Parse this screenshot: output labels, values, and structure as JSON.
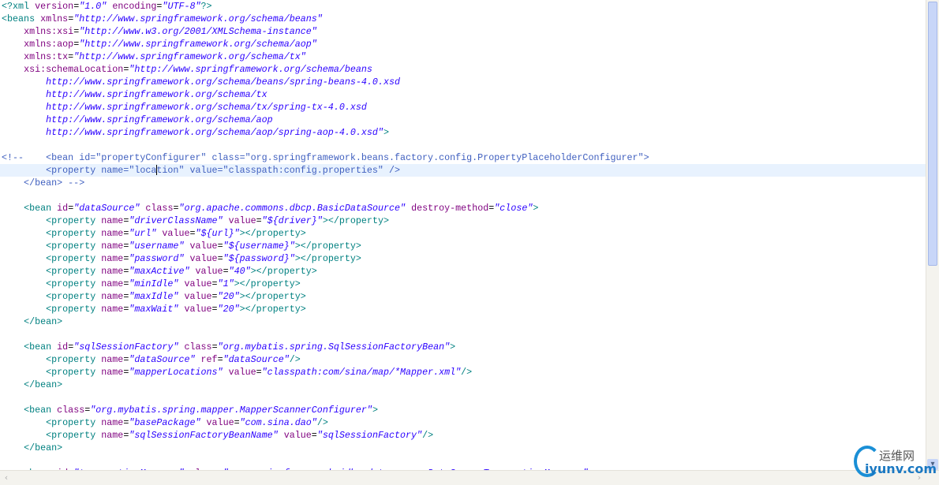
{
  "editor": {
    "current_line": 13,
    "caret": {
      "line": 13,
      "token": 3,
      "offset": 4
    },
    "lines": [
      [
        [
          "pi",
          "<?"
        ],
        [
          "tag",
          "xml "
        ],
        [
          "attr",
          "version"
        ],
        [
          "text",
          "="
        ],
        [
          "val",
          "\"1.0\""
        ],
        [
          "text",
          " "
        ],
        [
          "attr",
          "encoding"
        ],
        [
          "text",
          "="
        ],
        [
          "val",
          "\"UTF-8\""
        ],
        [
          "pi",
          "?>"
        ]
      ],
      [
        [
          "tag",
          "<beans "
        ],
        [
          "attr",
          "xmlns"
        ],
        [
          "text",
          "="
        ],
        [
          "val",
          "\"http://www.springframework.org/schema/beans\""
        ]
      ],
      [
        [
          "text",
          "    "
        ],
        [
          "attr",
          "xmlns:xsi"
        ],
        [
          "text",
          "="
        ],
        [
          "val",
          "\"http://www.w3.org/2001/XMLSchema-instance\""
        ]
      ],
      [
        [
          "text",
          "    "
        ],
        [
          "attr",
          "xmlns:aop"
        ],
        [
          "text",
          "="
        ],
        [
          "val",
          "\"http://www.springframework.org/schema/aop\""
        ]
      ],
      [
        [
          "text",
          "    "
        ],
        [
          "attr",
          "xmlns:tx"
        ],
        [
          "text",
          "="
        ],
        [
          "val",
          "\"http://www.springframework.org/schema/tx\""
        ]
      ],
      [
        [
          "text",
          "    "
        ],
        [
          "attr",
          "xsi:schemaLocation"
        ],
        [
          "text",
          "="
        ],
        [
          "val",
          "\"http://www.springframework.org/schema/beans"
        ]
      ],
      [
        [
          "text",
          "        "
        ],
        [
          "val",
          "http://www.springframework.org/schema/beans/spring-beans-4.0.xsd"
        ]
      ],
      [
        [
          "text",
          "        "
        ],
        [
          "val",
          "http://www.springframework.org/schema/tx"
        ]
      ],
      [
        [
          "text",
          "        "
        ],
        [
          "val",
          "http://www.springframework.org/schema/tx/spring-tx-4.0.xsd"
        ]
      ],
      [
        [
          "text",
          "        "
        ],
        [
          "val",
          "http://www.springframework.org/schema/aop"
        ]
      ],
      [
        [
          "text",
          "        "
        ],
        [
          "val",
          "http://www.springframework.org/schema/aop/spring-aop-4.0.xsd\""
        ],
        [
          "tag",
          ">"
        ]
      ],
      [],
      [
        [
          "com",
          "<!--    <bean id=\"propertyConfigurer\" class=\"org.springframework.beans.factory.config.PropertyPlaceholderConfigurer\">"
        ]
      ],
      [
        [
          "com",
          "        <property name=\"loca"
        ],
        [
          "com",
          "tion\" value=\"classpath:config.properties\" />"
        ]
      ],
      [
        [
          "com",
          "    </bean> -->"
        ]
      ],
      [],
      [
        [
          "text",
          "    "
        ],
        [
          "tag",
          "<bean "
        ],
        [
          "attr",
          "id"
        ],
        [
          "text",
          "="
        ],
        [
          "val",
          "\"dataSource\""
        ],
        [
          "text",
          " "
        ],
        [
          "attr",
          "class"
        ],
        [
          "text",
          "="
        ],
        [
          "val",
          "\"org.apache.commons.dbcp.BasicDataSource\""
        ],
        [
          "text",
          " "
        ],
        [
          "attr",
          "destroy-method"
        ],
        [
          "text",
          "="
        ],
        [
          "val",
          "\"close\""
        ],
        [
          "tag",
          ">"
        ]
      ],
      [
        [
          "text",
          "        "
        ],
        [
          "tag",
          "<property "
        ],
        [
          "attr",
          "name"
        ],
        [
          "text",
          "="
        ],
        [
          "val",
          "\"driverClassName\""
        ],
        [
          "text",
          " "
        ],
        [
          "attr",
          "value"
        ],
        [
          "text",
          "="
        ],
        [
          "val",
          "\"${driver}\""
        ],
        [
          "tag",
          "></property>"
        ]
      ],
      [
        [
          "text",
          "        "
        ],
        [
          "tag",
          "<property "
        ],
        [
          "attr",
          "name"
        ],
        [
          "text",
          "="
        ],
        [
          "val",
          "\"url\""
        ],
        [
          "text",
          " "
        ],
        [
          "attr",
          "value"
        ],
        [
          "text",
          "="
        ],
        [
          "val",
          "\"${url}\""
        ],
        [
          "tag",
          "></property>"
        ]
      ],
      [
        [
          "text",
          "        "
        ],
        [
          "tag",
          "<property "
        ],
        [
          "attr",
          "name"
        ],
        [
          "text",
          "="
        ],
        [
          "val",
          "\"username\""
        ],
        [
          "text",
          " "
        ],
        [
          "attr",
          "value"
        ],
        [
          "text",
          "="
        ],
        [
          "val",
          "\"${username}\""
        ],
        [
          "tag",
          "></property>"
        ]
      ],
      [
        [
          "text",
          "        "
        ],
        [
          "tag",
          "<property "
        ],
        [
          "attr",
          "name"
        ],
        [
          "text",
          "="
        ],
        [
          "val",
          "\"password\""
        ],
        [
          "text",
          " "
        ],
        [
          "attr",
          "value"
        ],
        [
          "text",
          "="
        ],
        [
          "val",
          "\"${password}\""
        ],
        [
          "tag",
          "></property>"
        ]
      ],
      [
        [
          "text",
          "        "
        ],
        [
          "tag",
          "<property "
        ],
        [
          "attr",
          "name"
        ],
        [
          "text",
          "="
        ],
        [
          "val",
          "\"maxActive\""
        ],
        [
          "text",
          " "
        ],
        [
          "attr",
          "value"
        ],
        [
          "text",
          "="
        ],
        [
          "val",
          "\"40\""
        ],
        [
          "tag",
          "></property>"
        ]
      ],
      [
        [
          "text",
          "        "
        ],
        [
          "tag",
          "<property "
        ],
        [
          "attr",
          "name"
        ],
        [
          "text",
          "="
        ],
        [
          "val",
          "\"minIdle\""
        ],
        [
          "text",
          " "
        ],
        [
          "attr",
          "value"
        ],
        [
          "text",
          "="
        ],
        [
          "val",
          "\"1\""
        ],
        [
          "tag",
          "></property>"
        ]
      ],
      [
        [
          "text",
          "        "
        ],
        [
          "tag",
          "<property "
        ],
        [
          "attr",
          "name"
        ],
        [
          "text",
          "="
        ],
        [
          "val",
          "\"maxIdle\""
        ],
        [
          "text",
          " "
        ],
        [
          "attr",
          "value"
        ],
        [
          "text",
          "="
        ],
        [
          "val",
          "\"20\""
        ],
        [
          "tag",
          "></property>"
        ]
      ],
      [
        [
          "text",
          "        "
        ],
        [
          "tag",
          "<property "
        ],
        [
          "attr",
          "name"
        ],
        [
          "text",
          "="
        ],
        [
          "val",
          "\"maxWait\""
        ],
        [
          "text",
          " "
        ],
        [
          "attr",
          "value"
        ],
        [
          "text",
          "="
        ],
        [
          "val",
          "\"20\""
        ],
        [
          "tag",
          "></property>"
        ]
      ],
      [
        [
          "text",
          "    "
        ],
        [
          "tag",
          "</bean>"
        ]
      ],
      [],
      [
        [
          "text",
          "    "
        ],
        [
          "tag",
          "<bean "
        ],
        [
          "attr",
          "id"
        ],
        [
          "text",
          "="
        ],
        [
          "val",
          "\"sqlSessionFactory\""
        ],
        [
          "text",
          " "
        ],
        [
          "attr",
          "class"
        ],
        [
          "text",
          "="
        ],
        [
          "val",
          "\"org.mybatis.spring.SqlSessionFactoryBean\""
        ],
        [
          "tag",
          ">"
        ]
      ],
      [
        [
          "text",
          "        "
        ],
        [
          "tag",
          "<property "
        ],
        [
          "attr",
          "name"
        ],
        [
          "text",
          "="
        ],
        [
          "val",
          "\"dataSource\""
        ],
        [
          "text",
          " "
        ],
        [
          "attr",
          "ref"
        ],
        [
          "text",
          "="
        ],
        [
          "val",
          "\"dataSource\""
        ],
        [
          "tag",
          "/>"
        ]
      ],
      [
        [
          "text",
          "        "
        ],
        [
          "tag",
          "<property "
        ],
        [
          "attr",
          "name"
        ],
        [
          "text",
          "="
        ],
        [
          "val",
          "\"mapperLocations\""
        ],
        [
          "text",
          " "
        ],
        [
          "attr",
          "value"
        ],
        [
          "text",
          "="
        ],
        [
          "val",
          "\"classpath:com/sina/map/*Mapper.xml\""
        ],
        [
          "tag",
          "/>"
        ]
      ],
      [
        [
          "text",
          "    "
        ],
        [
          "tag",
          "</bean>"
        ]
      ],
      [],
      [
        [
          "text",
          "    "
        ],
        [
          "tag",
          "<bean "
        ],
        [
          "attr",
          "class"
        ],
        [
          "text",
          "="
        ],
        [
          "val",
          "\"org.mybatis.spring.mapper.MapperScannerConfigurer\""
        ],
        [
          "tag",
          ">"
        ]
      ],
      [
        [
          "text",
          "        "
        ],
        [
          "tag",
          "<property "
        ],
        [
          "attr",
          "name"
        ],
        [
          "text",
          "="
        ],
        [
          "val",
          "\"basePackage\""
        ],
        [
          "text",
          " "
        ],
        [
          "attr",
          "value"
        ],
        [
          "text",
          "="
        ],
        [
          "val",
          "\"com.sina.dao\""
        ],
        [
          "tag",
          "/>"
        ]
      ],
      [
        [
          "text",
          "        "
        ],
        [
          "tag",
          "<property "
        ],
        [
          "attr",
          "name"
        ],
        [
          "text",
          "="
        ],
        [
          "val",
          "\"sqlSessionFactoryBeanName\""
        ],
        [
          "text",
          " "
        ],
        [
          "attr",
          "value"
        ],
        [
          "text",
          "="
        ],
        [
          "val",
          "\"sqlSessionFactory\""
        ],
        [
          "tag",
          "/>"
        ]
      ],
      [
        [
          "text",
          "    "
        ],
        [
          "tag",
          "</bean>"
        ]
      ],
      [],
      [
        [
          "text",
          "    "
        ],
        [
          "tag",
          "<bean "
        ],
        [
          "attr",
          "id"
        ],
        [
          "text",
          "="
        ],
        [
          "val",
          "\"transactionManager\""
        ],
        [
          "text",
          " "
        ],
        [
          "attr",
          "class"
        ],
        [
          "text",
          "="
        ],
        [
          "val",
          "\"org.springframework.jdbc.datasource.DataSourceTransactionManager\""
        ],
        [
          "tag",
          ">"
        ]
      ]
    ]
  },
  "scrollbars": {
    "down_icon": "▾",
    "left_icon": "‹",
    "right_icon": "›"
  },
  "watermark": {
    "cn": "运维网",
    "en": "iyunv.com"
  }
}
